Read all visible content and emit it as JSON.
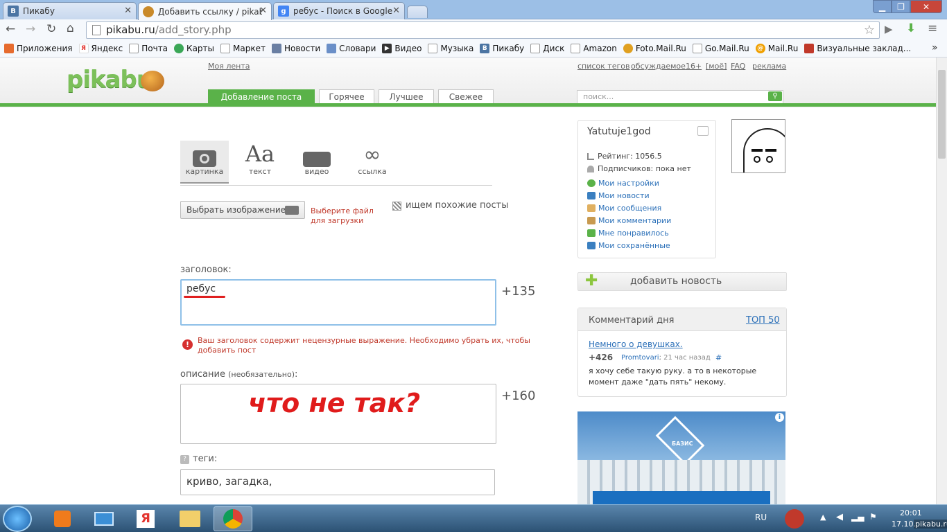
{
  "browser": {
    "tabs": [
      {
        "label": "Пикабу",
        "icon": "vk-icon",
        "color": "#4c75a3"
      },
      {
        "label": "Добавить ссылку / pikab",
        "icon": "pikabu-icon",
        "color": "#c98a2a"
      },
      {
        "label": "ребус - Поиск в Google",
        "icon": "google-icon",
        "color": "#4285f4"
      }
    ],
    "url_host": "pikabu.ru",
    "url_path": "/add_story.php",
    "bookmarks": [
      {
        "label": "Приложения",
        "icon": "apps-icon",
        "color": "#e66b2e"
      },
      {
        "label": "Яндекс",
        "icon": "yandex-icon",
        "color": "#e3342f"
      },
      {
        "label": "Почта",
        "icon": "page-icon",
        "color": "#999999"
      },
      {
        "label": "Карты",
        "icon": "maps-icon",
        "color": "#3aa757"
      },
      {
        "label": "Маркет",
        "icon": "page-icon",
        "color": "#999999"
      },
      {
        "label": "Новости",
        "icon": "news-icon",
        "color": "#6a7fa3"
      },
      {
        "label": "Словари",
        "icon": "dict-icon",
        "color": "#6a8fc8"
      },
      {
        "label": "Видео",
        "icon": "video-icon",
        "color": "#333333"
      },
      {
        "label": "Музыка",
        "icon": "page-icon",
        "color": "#999999"
      },
      {
        "label": "Пикабу",
        "icon": "vk-icon",
        "color": "#4c75a3"
      },
      {
        "label": "Диск",
        "icon": "page-icon",
        "color": "#999999"
      },
      {
        "label": "Amazon",
        "icon": "page-icon",
        "color": "#999999"
      },
      {
        "label": "Foto.Mail.Ru",
        "icon": "foto-icon",
        "color": "#e0a020"
      },
      {
        "label": "Go.Mail.Ru",
        "icon": "page-icon",
        "color": "#999999"
      },
      {
        "label": "Mail.Ru",
        "icon": "mailru-icon",
        "color": "#f0a000"
      },
      {
        "label": "Визуальные заклад...",
        "icon": "visual-icon",
        "color": "#c0392b"
      }
    ],
    "bookmarks_more": "»"
  },
  "site": {
    "logo": "pikabu",
    "my_feed": "Моя лента",
    "top_links": [
      "список тегов",
      "обсуждаемое",
      "16+",
      "[моё]",
      "FAQ",
      "реклама"
    ],
    "nav_tabs": [
      "Добавление поста",
      "Горячее",
      "Лучшее",
      "Свежее"
    ],
    "search_placeholder": "поиск..."
  },
  "post_types": [
    {
      "label": "картинка",
      "icon": "camera-icon"
    },
    {
      "label": "текст",
      "icon": "text-icon",
      "glyph": "Aa"
    },
    {
      "label": "видео",
      "icon": "video-camera-icon"
    },
    {
      "label": "ссылка",
      "icon": "link-icon"
    }
  ],
  "form": {
    "choose_image": "Выбрать изображение",
    "choose_hint": "Выберите файл для загрузки",
    "similar_posts": "ищем похожие посты",
    "title_label": "заголовок:",
    "title_value": "ребус",
    "title_counter": "+135",
    "error_text": "Ваш заголовок содержит нецензурные выражение. Необходимо убрать их, чтобы добавить пост",
    "desc_label": "описание",
    "desc_optional": "(необязательно)",
    "desc_colon": ":",
    "desc_counter": "+160",
    "annotation": "что не так?",
    "tags_label": "теги:",
    "tags_value": "криво, загадка,"
  },
  "sidebar": {
    "username": "Yatutuje1god",
    "rating": "Рейтинг: 1056.5",
    "subscribers": "Подписчиков: пока нет",
    "links": [
      {
        "label": "Мои настройки",
        "icon": "gear-icon",
        "color": "#5ab249"
      },
      {
        "label": "Мои новости",
        "icon": "news-icon",
        "color": "#3a7fc0"
      },
      {
        "label": "Мои сообщения",
        "icon": "envelope-icon",
        "color": "#e0b060"
      },
      {
        "label": "Мои комментарии",
        "icon": "comment-icon",
        "color": "#c89a50"
      },
      {
        "label": "Мне понравилось",
        "icon": "thumb-icon",
        "color": "#5ab249"
      },
      {
        "label": "Мои сохранённые",
        "icon": "save-icon",
        "color": "#3a7fc0"
      }
    ],
    "add_news": "добавить новость",
    "comment_of_day": "Комментарий дня",
    "top50": "ТОП 50",
    "comment_post": "Немного о девушках.",
    "comment_score": "+426",
    "comment_author": "Promtovari",
    "comment_time": "; 21 час назад",
    "comment_hash": "#",
    "comment_text": "я хочу себе такую руку. а то в некоторые момент даже \"дать пять\" некому.",
    "ad_brand": "БАЗИС"
  },
  "taskbar": {
    "lang": "RU",
    "time": "20:01",
    "date": "17.10.",
    "watermark": "pikabu.ru"
  }
}
